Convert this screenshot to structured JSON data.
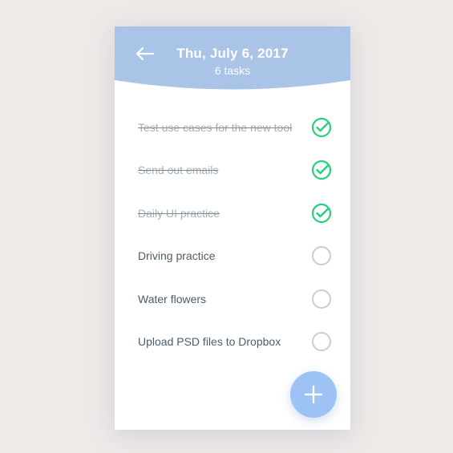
{
  "header": {
    "date": "Thu, July 6, 2017",
    "task_count": "6 tasks"
  },
  "icons": {
    "back": "arrow-left-icon",
    "check_done": "check-circle-icon",
    "check_todo": "empty-circle-icon",
    "add": "plus-icon"
  },
  "colors": {
    "header": "#a9c4e6",
    "done_check": "#27d07a",
    "todo_check": "#c9ced3",
    "fab": "#9cc3f4",
    "background": "#eeeae8"
  },
  "tasks": [
    {
      "label": "Test use cases for the new tool",
      "done": true
    },
    {
      "label": "Send out emails",
      "done": true
    },
    {
      "label": "Daily UI practice",
      "done": true
    },
    {
      "label": "Driving practice",
      "done": false
    },
    {
      "label": "Water flowers",
      "done": false
    },
    {
      "label": "Upload PSD files to Dropbox",
      "done": false
    }
  ]
}
